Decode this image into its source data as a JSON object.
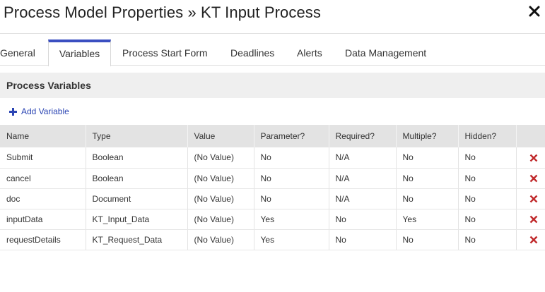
{
  "dialog": {
    "title": "Process Model Properties » KT Input Process",
    "close_icon": "close-icon"
  },
  "tabs": [
    {
      "label": "General",
      "active": false
    },
    {
      "label": "Variables",
      "active": true
    },
    {
      "label": "Process Start Form",
      "active": false
    },
    {
      "label": "Deadlines",
      "active": false
    },
    {
      "label": "Alerts",
      "active": false
    },
    {
      "label": "Data Management",
      "active": false
    }
  ],
  "section": {
    "title": "Process Variables",
    "add_label": "Add Variable"
  },
  "colors": {
    "accent": "#3a4fc1",
    "link": "#2a44b3",
    "delete": "#c0292b"
  },
  "table": {
    "columns": [
      "Name",
      "Type",
      "Value",
      "Parameter?",
      "Required?",
      "Multiple?",
      "Hidden?"
    ],
    "rows": [
      {
        "name": "Submit",
        "type": "Boolean",
        "value": "(No Value)",
        "parameter": "No",
        "required": "N/A",
        "multiple": "No",
        "hidden": "No"
      },
      {
        "name": "cancel",
        "type": "Boolean",
        "value": "(No Value)",
        "parameter": "No",
        "required": "N/A",
        "multiple": "No",
        "hidden": "No"
      },
      {
        "name": "doc",
        "type": "Document",
        "value": "(No Value)",
        "parameter": "No",
        "required": "N/A",
        "multiple": "No",
        "hidden": "No"
      },
      {
        "name": "inputData",
        "type": "KT_Input_Data",
        "value": "(No Value)",
        "parameter": "Yes",
        "required": "No",
        "multiple": "Yes",
        "hidden": "No"
      },
      {
        "name": "requestDetails",
        "type": "KT_Request_Data",
        "value": "(No Value)",
        "parameter": "Yes",
        "required": "No",
        "multiple": "No",
        "hidden": "No"
      }
    ]
  }
}
